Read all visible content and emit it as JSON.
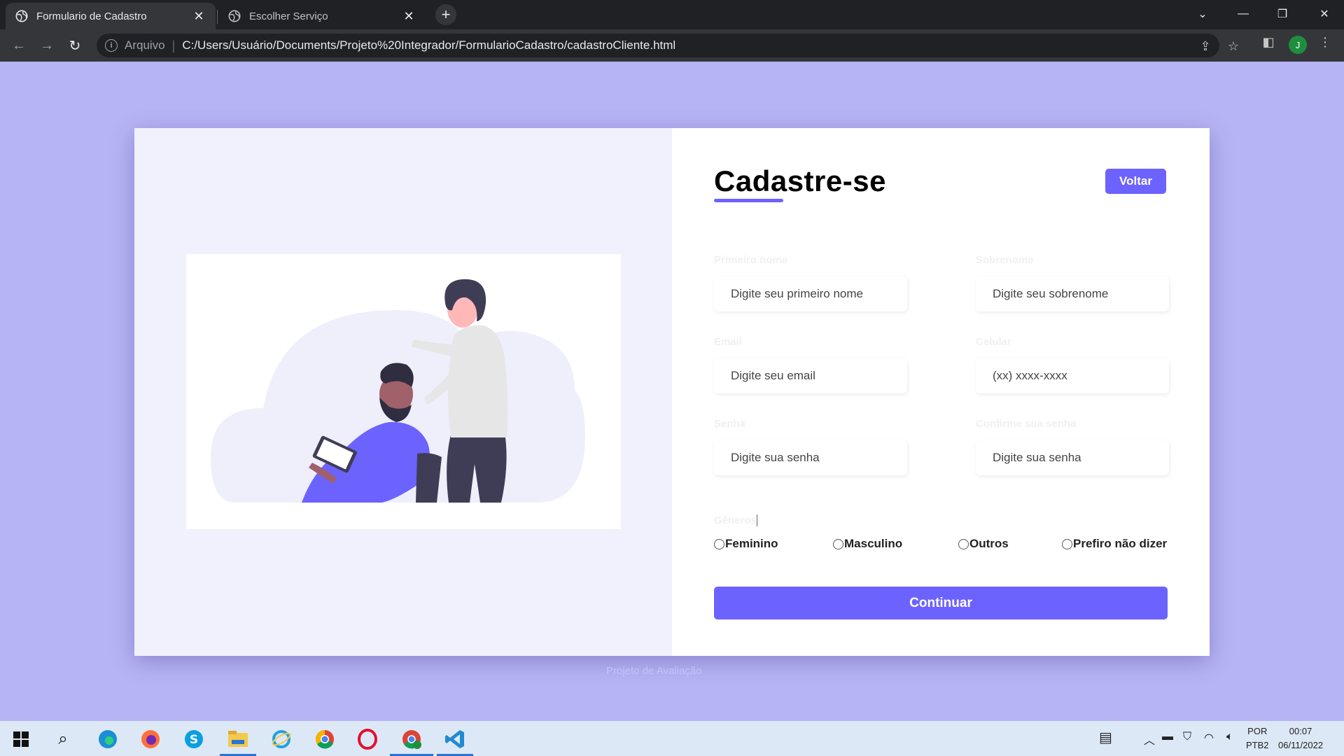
{
  "browser": {
    "tabs": [
      {
        "title": "Formulario de Cadastro",
        "active": true
      },
      {
        "title": "Escolher Serviço",
        "active": false
      }
    ],
    "new_tab_glyph": "+",
    "address": {
      "protocol": "Arquivo",
      "url": "C:/Users/Usuário/Documents/Projeto%20Integrador/FormularioCadastro/cadastroCliente.html"
    },
    "profile_initial": "J"
  },
  "form": {
    "title": "Cadastre-se",
    "back_label": "Voltar",
    "fields": {
      "first_name": {
        "label": "Primeiro nome",
        "placeholder": "Digite seu primeiro nome"
      },
      "last_name": {
        "label": "Sobrenome",
        "placeholder": "Digite seu sobrenome"
      },
      "email": {
        "label": "Email",
        "placeholder": "Digite seu email"
      },
      "phone": {
        "label": "Celular",
        "placeholder": "(xx) xxxx-xxxx"
      },
      "password": {
        "label": "Senha",
        "placeholder": "Digite sua senha"
      },
      "confirm_password": {
        "label": "Confirme sua senha",
        "placeholder": "Digite sua senha"
      }
    },
    "gender": {
      "title": "Gêneros",
      "options": [
        "Feminino",
        "Masculino",
        "Outros",
        "Prefiro não dizer"
      ]
    },
    "continue_label": "Continuar"
  },
  "footer": {
    "text": "Projeto de Avaliação"
  },
  "taskbar": {
    "language": "POR",
    "keyboard": "PTB2",
    "time": "00:07",
    "date": "06/11/2022"
  },
  "colors": {
    "page_background": "#b6b4f4",
    "accent": "#6c63ff",
    "left_panel": "#f1f0fd"
  }
}
